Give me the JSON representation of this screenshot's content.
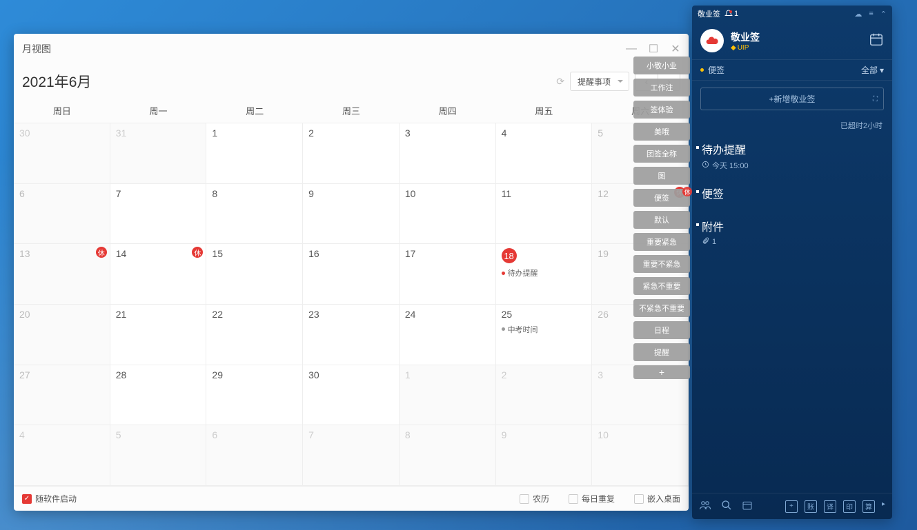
{
  "calendar": {
    "window_title": "月视图",
    "month_label": "2021年6月",
    "dropdown_label": "提醒事项",
    "day_headers": [
      "周日",
      "周一",
      "周二",
      "周三",
      "周四",
      "周五",
      "周六"
    ],
    "grid": [
      [
        {
          "n": "30",
          "m": true
        },
        {
          "n": "31",
          "m": true
        },
        {
          "n": "1"
        },
        {
          "n": "2"
        },
        {
          "n": "3"
        },
        {
          "n": "4"
        },
        {
          "n": "5",
          "w": true
        }
      ],
      [
        {
          "n": "6",
          "w": true
        },
        {
          "n": "7"
        },
        {
          "n": "8"
        },
        {
          "n": "9"
        },
        {
          "n": "10"
        },
        {
          "n": "11"
        },
        {
          "n": "12",
          "w": true,
          "hol": true
        }
      ],
      [
        {
          "n": "13",
          "w": true,
          "hol": true
        },
        {
          "n": "14",
          "hol": true
        },
        {
          "n": "15"
        },
        {
          "n": "16"
        },
        {
          "n": "17"
        },
        {
          "n": "18",
          "today": true,
          "ev": "待办提醒",
          "red": true
        },
        {
          "n": "19",
          "w": true
        }
      ],
      [
        {
          "n": "20",
          "w": true
        },
        {
          "n": "21"
        },
        {
          "n": "22"
        },
        {
          "n": "23"
        },
        {
          "n": "24"
        },
        {
          "n": "25",
          "ev": "中考时间"
        },
        {
          "n": "26",
          "w": true
        }
      ],
      [
        {
          "n": "27",
          "w": true
        },
        {
          "n": "28"
        },
        {
          "n": "29"
        },
        {
          "n": "30"
        },
        {
          "n": "1",
          "m": true
        },
        {
          "n": "2",
          "m": true
        },
        {
          "n": "3",
          "m": true
        }
      ],
      [
        {
          "n": "4",
          "m": true
        },
        {
          "n": "5",
          "m": true
        },
        {
          "n": "6",
          "m": true
        },
        {
          "n": "7",
          "m": true
        },
        {
          "n": "8",
          "m": true
        },
        {
          "n": "9",
          "m": true
        },
        {
          "n": "10",
          "m": true
        }
      ]
    ],
    "holiday_char": "休",
    "footer": {
      "startup": "随软件启动",
      "lunar": "农历",
      "repeat": "每日重复",
      "embed": "嵌入桌面"
    }
  },
  "tags": [
    "小敬小业",
    "工作注",
    "签体验",
    "美哦",
    "团签全称",
    "图",
    "便签",
    "默认",
    "重要紧急",
    "重要不紧急",
    "紧急不重要",
    "不紧急不重要",
    "日程",
    "提醒"
  ],
  "panel": {
    "titlebar": "敬业签",
    "notif_count": "1",
    "brand": "敬业签",
    "vip": "UIP",
    "section_label": "便签",
    "all_label": "全部",
    "new_note": "新增敬业签",
    "overdue": "已超时2小时",
    "items": [
      {
        "title": "待办提醒",
        "meta": "今天 15:00",
        "clock": true
      },
      {
        "title": "便签"
      },
      {
        "title": "附件",
        "attach": "1"
      }
    ]
  }
}
